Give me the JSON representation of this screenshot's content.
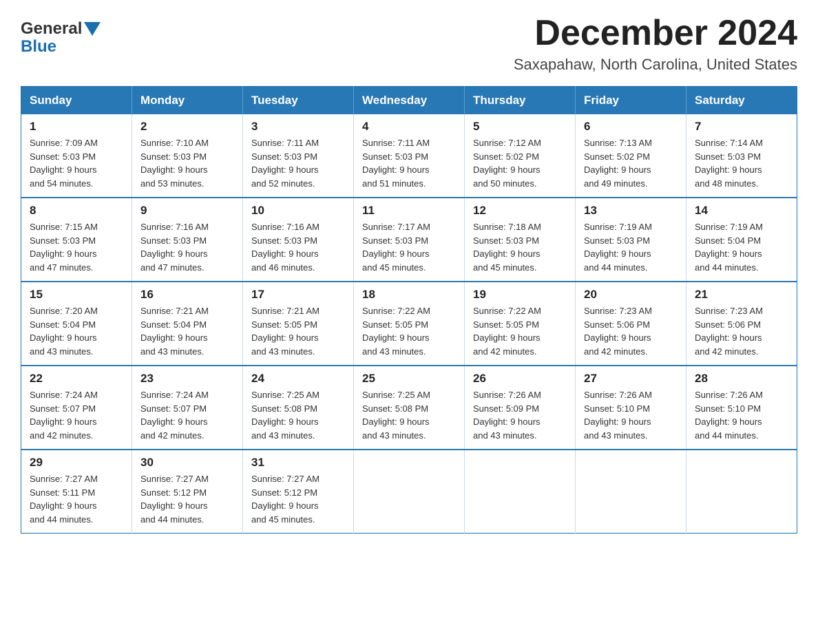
{
  "logo": {
    "part1": "General",
    "part2": "Blue"
  },
  "header": {
    "month": "December 2024",
    "location": "Saxapahaw, North Carolina, United States"
  },
  "weekdays": [
    "Sunday",
    "Monday",
    "Tuesday",
    "Wednesday",
    "Thursday",
    "Friday",
    "Saturday"
  ],
  "weeks": [
    [
      {
        "day": "1",
        "info": "Sunrise: 7:09 AM\nSunset: 5:03 PM\nDaylight: 9 hours\nand 54 minutes."
      },
      {
        "day": "2",
        "info": "Sunrise: 7:10 AM\nSunset: 5:03 PM\nDaylight: 9 hours\nand 53 minutes."
      },
      {
        "day": "3",
        "info": "Sunrise: 7:11 AM\nSunset: 5:03 PM\nDaylight: 9 hours\nand 52 minutes."
      },
      {
        "day": "4",
        "info": "Sunrise: 7:11 AM\nSunset: 5:03 PM\nDaylight: 9 hours\nand 51 minutes."
      },
      {
        "day": "5",
        "info": "Sunrise: 7:12 AM\nSunset: 5:02 PM\nDaylight: 9 hours\nand 50 minutes."
      },
      {
        "day": "6",
        "info": "Sunrise: 7:13 AM\nSunset: 5:02 PM\nDaylight: 9 hours\nand 49 minutes."
      },
      {
        "day": "7",
        "info": "Sunrise: 7:14 AM\nSunset: 5:03 PM\nDaylight: 9 hours\nand 48 minutes."
      }
    ],
    [
      {
        "day": "8",
        "info": "Sunrise: 7:15 AM\nSunset: 5:03 PM\nDaylight: 9 hours\nand 47 minutes."
      },
      {
        "day": "9",
        "info": "Sunrise: 7:16 AM\nSunset: 5:03 PM\nDaylight: 9 hours\nand 47 minutes."
      },
      {
        "day": "10",
        "info": "Sunrise: 7:16 AM\nSunset: 5:03 PM\nDaylight: 9 hours\nand 46 minutes."
      },
      {
        "day": "11",
        "info": "Sunrise: 7:17 AM\nSunset: 5:03 PM\nDaylight: 9 hours\nand 45 minutes."
      },
      {
        "day": "12",
        "info": "Sunrise: 7:18 AM\nSunset: 5:03 PM\nDaylight: 9 hours\nand 45 minutes."
      },
      {
        "day": "13",
        "info": "Sunrise: 7:19 AM\nSunset: 5:03 PM\nDaylight: 9 hours\nand 44 minutes."
      },
      {
        "day": "14",
        "info": "Sunrise: 7:19 AM\nSunset: 5:04 PM\nDaylight: 9 hours\nand 44 minutes."
      }
    ],
    [
      {
        "day": "15",
        "info": "Sunrise: 7:20 AM\nSunset: 5:04 PM\nDaylight: 9 hours\nand 43 minutes."
      },
      {
        "day": "16",
        "info": "Sunrise: 7:21 AM\nSunset: 5:04 PM\nDaylight: 9 hours\nand 43 minutes."
      },
      {
        "day": "17",
        "info": "Sunrise: 7:21 AM\nSunset: 5:05 PM\nDaylight: 9 hours\nand 43 minutes."
      },
      {
        "day": "18",
        "info": "Sunrise: 7:22 AM\nSunset: 5:05 PM\nDaylight: 9 hours\nand 43 minutes."
      },
      {
        "day": "19",
        "info": "Sunrise: 7:22 AM\nSunset: 5:05 PM\nDaylight: 9 hours\nand 42 minutes."
      },
      {
        "day": "20",
        "info": "Sunrise: 7:23 AM\nSunset: 5:06 PM\nDaylight: 9 hours\nand 42 minutes."
      },
      {
        "day": "21",
        "info": "Sunrise: 7:23 AM\nSunset: 5:06 PM\nDaylight: 9 hours\nand 42 minutes."
      }
    ],
    [
      {
        "day": "22",
        "info": "Sunrise: 7:24 AM\nSunset: 5:07 PM\nDaylight: 9 hours\nand 42 minutes."
      },
      {
        "day": "23",
        "info": "Sunrise: 7:24 AM\nSunset: 5:07 PM\nDaylight: 9 hours\nand 42 minutes."
      },
      {
        "day": "24",
        "info": "Sunrise: 7:25 AM\nSunset: 5:08 PM\nDaylight: 9 hours\nand 43 minutes."
      },
      {
        "day": "25",
        "info": "Sunrise: 7:25 AM\nSunset: 5:08 PM\nDaylight: 9 hours\nand 43 minutes."
      },
      {
        "day": "26",
        "info": "Sunrise: 7:26 AM\nSunset: 5:09 PM\nDaylight: 9 hours\nand 43 minutes."
      },
      {
        "day": "27",
        "info": "Sunrise: 7:26 AM\nSunset: 5:10 PM\nDaylight: 9 hours\nand 43 minutes."
      },
      {
        "day": "28",
        "info": "Sunrise: 7:26 AM\nSunset: 5:10 PM\nDaylight: 9 hours\nand 44 minutes."
      }
    ],
    [
      {
        "day": "29",
        "info": "Sunrise: 7:27 AM\nSunset: 5:11 PM\nDaylight: 9 hours\nand 44 minutes."
      },
      {
        "day": "30",
        "info": "Sunrise: 7:27 AM\nSunset: 5:12 PM\nDaylight: 9 hours\nand 44 minutes."
      },
      {
        "day": "31",
        "info": "Sunrise: 7:27 AM\nSunset: 5:12 PM\nDaylight: 9 hours\nand 45 minutes."
      },
      {
        "day": "",
        "info": ""
      },
      {
        "day": "",
        "info": ""
      },
      {
        "day": "",
        "info": ""
      },
      {
        "day": "",
        "info": ""
      }
    ]
  ]
}
